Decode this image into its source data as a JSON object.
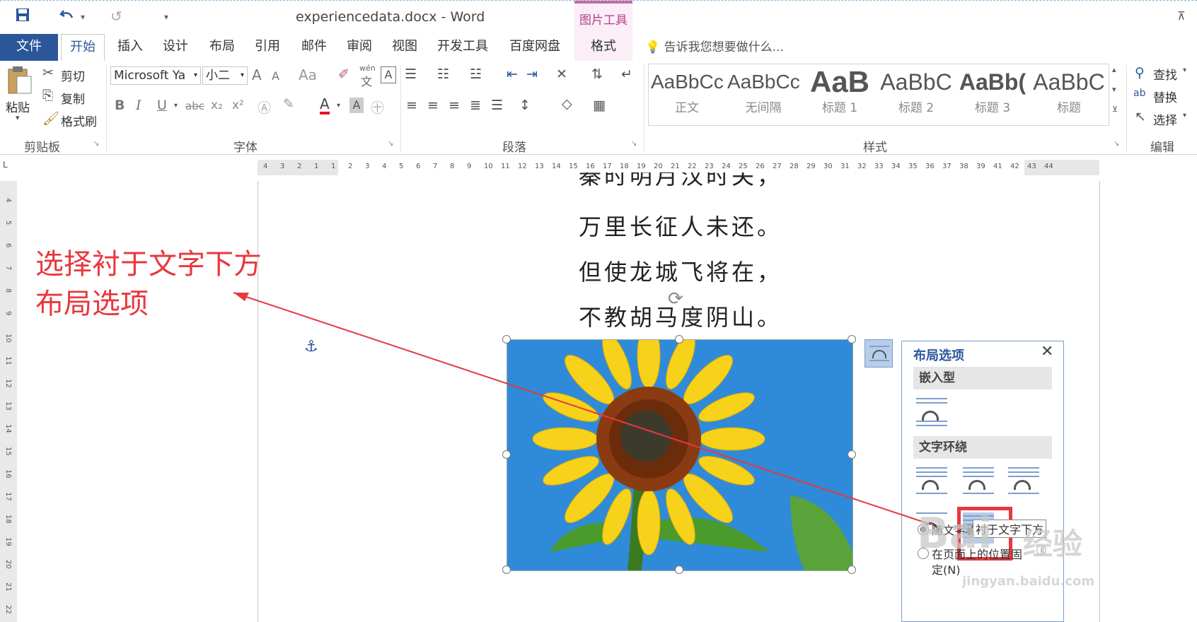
{
  "window": {
    "doc_title": "experiencedata.docx - Word",
    "contextual_tools": "图片工具"
  },
  "tabs": {
    "file": "文件",
    "home": "开始",
    "insert": "插入",
    "design": "设计",
    "layout": "布局",
    "references": "引用",
    "mailings": "邮件",
    "review": "审阅",
    "view": "视图",
    "developer": "开发工具",
    "baidu": "百度网盘",
    "format": "格式"
  },
  "tell_me": "告诉我您想要做什么...",
  "clipboard": {
    "paste": "粘贴",
    "cut": "剪切",
    "copy": "复制",
    "format_painter": "格式刷",
    "label": "剪贴板"
  },
  "font": {
    "name": "Microsoft Ya",
    "size": "小二",
    "label": "字体",
    "grow": "A",
    "shrink": "A",
    "case": "Aa",
    "bold": "B",
    "italic": "I",
    "underline": "U",
    "strike": "abc",
    "subscript": "x₂",
    "superscript": "x²",
    "font_color": "A",
    "pinyin_top": "wén",
    "pinyin_bottom": "文"
  },
  "paragraph": {
    "label": "段落"
  },
  "styles": {
    "label": "样式",
    "items": [
      {
        "sample": "AaBbCcI",
        "name": "正文"
      },
      {
        "sample": "AaBbCcI",
        "name": "无间隔"
      },
      {
        "sample": "AaB",
        "name": "标题 1"
      },
      {
        "sample": "AaBbC",
        "name": "标题 2"
      },
      {
        "sample": "AaBb(",
        "name": "标题 3"
      },
      {
        "sample": "AaBbC",
        "name": "标题"
      }
    ]
  },
  "editing": {
    "find": "查找",
    "replace": "替换",
    "select": "选择",
    "label": "编辑"
  },
  "ruler_corner": "L",
  "ruler_numbers": [
    "4",
    "3",
    "2",
    "1",
    "1",
    "2",
    "3",
    "4",
    "5",
    "6",
    "7",
    "8",
    "9",
    "10",
    "11",
    "12",
    "13",
    "14",
    "15",
    "16",
    "17",
    "18",
    "19",
    "20",
    "21",
    "22",
    "23",
    "24",
    "25",
    "26",
    "27",
    "28",
    "29",
    "30",
    "31",
    "32",
    "33",
    "34",
    "35",
    "36",
    "37",
    "38",
    "39",
    "41",
    "42",
    "43",
    "44"
  ],
  "left_ruler_numbers": [
    "4",
    "5",
    "6",
    "7",
    "8",
    "9",
    "10",
    "11",
    "12",
    "13",
    "14",
    "15",
    "16",
    "17",
    "18",
    "19",
    "20",
    "21",
    "22"
  ],
  "poem": [
    "秦时明月汉时关，",
    "万里长征人未还。",
    "但使龙城飞将在，",
    "不教胡马度阴山。"
  ],
  "annotation": {
    "line1": "选择衬于文字下方",
    "line2": "布局选项",
    "color": "#e8383d"
  },
  "layout_options": {
    "title": "布局选项",
    "inline_section": "嵌入型",
    "wrap_section": "文字环绕",
    "tooltip": "衬于文字下方",
    "move_with_text": "随文字移",
    "fix_position_line1": "在页面上的位置固",
    "fix_position_line2": "定(N)"
  },
  "watermark": {
    "brand": "Bai",
    "brand_cn": "经验",
    "url": "jingyan.baidu.com"
  },
  "colors": {
    "accent": "#2b579a",
    "format_tab": "#b0418c",
    "highlight_box": "#e8383d"
  }
}
